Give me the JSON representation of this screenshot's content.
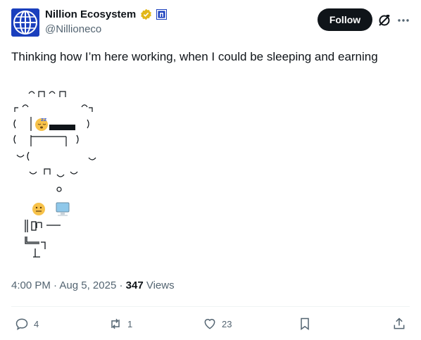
{
  "author": {
    "name": "Nillion Ecosystem",
    "handle": "@Nillioneco",
    "avatar_icon": "globe-logo",
    "verified_icon": "gold-verified-badge-icon",
    "affiliate_icon": "nillion-affiliate-badge-icon"
  },
  "header": {
    "follow_label": "Follow",
    "grok_icon": "grok-icon",
    "more_icon": "more-icon"
  },
  "tweet": {
    "text": "Thinking how I’m here working, when I could be sleeping and earning",
    "time": "4:00 PM",
    "separator": "·",
    "date": "Aug 5, 2025",
    "views_count": "347",
    "views_label": "Views"
  },
  "actions": {
    "replies": "4",
    "reposts": "1",
    "likes": "23"
  },
  "colors": {
    "text": "#0f1419",
    "muted": "#536471",
    "follow_bg": "#0f1419",
    "avatar_bg": "#1a3fbd",
    "verified": "#e2b719"
  }
}
